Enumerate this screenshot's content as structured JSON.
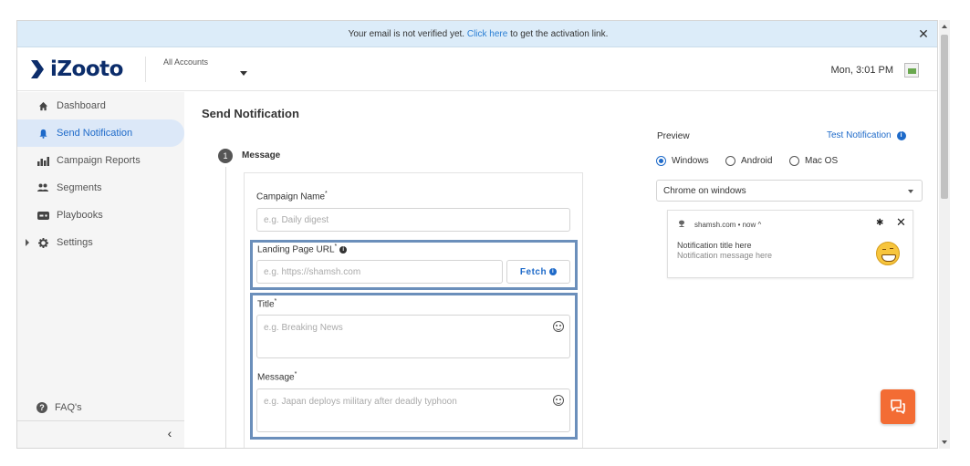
{
  "banner": {
    "text_before": "Your email is not verified yet.",
    "link": "Click here",
    "text_after": "to get the activation link.",
    "close": "✕"
  },
  "header": {
    "logo_text": "iZooto",
    "accounts_label": "All Accounts",
    "time": "Mon, 3:01 PM"
  },
  "sidebar": {
    "items": [
      {
        "label": "Dashboard",
        "icon": "home-icon"
      },
      {
        "label": "Send Notification",
        "icon": "bell-icon"
      },
      {
        "label": "Campaign Reports",
        "icon": "bar-chart-icon"
      },
      {
        "label": "Segments",
        "icon": "users-icon"
      },
      {
        "label": "Playbooks",
        "icon": "playbook-icon"
      },
      {
        "label": "Settings",
        "icon": "gear-icon"
      }
    ],
    "faq": "FAQ's",
    "collapse": "‹"
  },
  "main": {
    "page_title": "Send Notification",
    "step_number": "1",
    "step_label": "Message",
    "campaign_name": {
      "label": "Campaign Name",
      "placeholder": "e.g. Daily digest"
    },
    "landing_url": {
      "label": "Landing Page URL",
      "placeholder": "e.g. https://shamsh.com",
      "fetch_label": "Fetch"
    },
    "title_field": {
      "label": "Title",
      "placeholder": "e.g. Breaking News"
    },
    "message_field": {
      "label": "Message",
      "placeholder": "e.g. Japan deploys military after deadly typhoon"
    },
    "required_mark": "*"
  },
  "preview": {
    "label": "Preview",
    "test_notification": "Test Notification",
    "platforms": [
      "Windows",
      "Android",
      "Mac OS"
    ],
    "selected_platform": "Windows",
    "browser": "Chrome on windows",
    "notification": {
      "site": "shamsh.com",
      "time": "now",
      "title": "Notification title here",
      "message": "Notification message here"
    }
  },
  "colors": {
    "accent": "#1e6ac9",
    "chat_button": "#f36c34",
    "highlight_border": "#6b8fbb",
    "banner_bg": "#dcecf9"
  }
}
